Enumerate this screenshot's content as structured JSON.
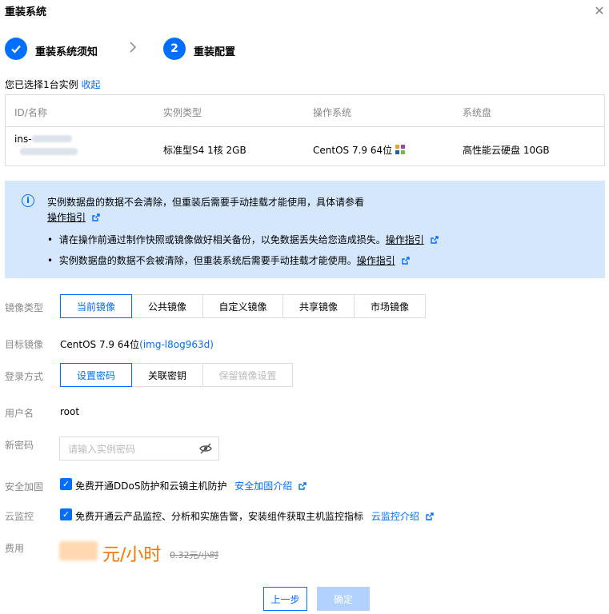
{
  "dialog": {
    "title": "重装系统",
    "close_icon": "close-icon"
  },
  "steps": [
    {
      "label": "重装系统须知",
      "state": "done",
      "icon": "check-icon"
    },
    {
      "label": "重装配置",
      "state": "current",
      "number": "2"
    }
  ],
  "selection": {
    "text": "您已选择1台实例",
    "collapse_link": "收起"
  },
  "instance_table": {
    "headers": [
      "ID/名称",
      "实例类型",
      "操作系统",
      "系统盘"
    ],
    "row": {
      "id_prefix": "ins-",
      "type": "标准型S4 1核 2GB",
      "os": "CentOS 7.9 64位",
      "os_icon": "centos-logo-icon",
      "disk": "高性能云硬盘 10GB"
    }
  },
  "notice": {
    "line1": "实例数据盘的数据不会清除，但重装后需要手动挂载才能使用，具体请参看",
    "line1_link": "操作指引",
    "bullets": [
      {
        "text": "请在操作前通过制作快照或镜像做好相关备份，以免数据丢失给您造成损失。",
        "link": "操作指引"
      },
      {
        "text": "实例数据盘的数据不会被清除，但重装系统后需要手动挂载才能使用。",
        "link": "操作指引"
      }
    ],
    "colors": {
      "background": "#d5e7fd",
      "accent": "#006eff"
    }
  },
  "form": {
    "image_type": {
      "label": "镜像类型",
      "options": [
        "当前镜像",
        "公共镜像",
        "自定义镜像",
        "共享镜像",
        "市场镜像"
      ],
      "selected": "当前镜像"
    },
    "target_image": {
      "label": "目标镜像",
      "value": "CentOS 7.9 64位",
      "image_id": "(img-l8og963d)"
    },
    "login_method": {
      "label": "登录方式",
      "options": [
        "设置密码",
        "关联密钥",
        "保留镜像设置"
      ],
      "selected": "设置密码",
      "disabled": [
        "保留镜像设置"
      ]
    },
    "username": {
      "label": "用户名",
      "value": "root"
    },
    "new_password": {
      "label": "新密码",
      "placeholder": "请输入实例密码",
      "value": ""
    },
    "security": {
      "label": "安全加固",
      "checked": true,
      "text": "免费开通DDoS防护和云镜主机防护",
      "link": "安全加固介绍"
    },
    "monitoring": {
      "label": "云监控",
      "checked": true,
      "text": "免费开通云产品监控、分析和实施告警，安装组件获取主机监控指标",
      "link": "云监控介绍"
    },
    "fee": {
      "label": "费用",
      "unit": "元/小时",
      "original": "0.32元/小时"
    }
  },
  "footer": {
    "prev_button": "上一步",
    "confirm_button": "确定"
  },
  "colors": {
    "primary": "#006eff",
    "price": "#ff7200",
    "muted": "#888888"
  }
}
